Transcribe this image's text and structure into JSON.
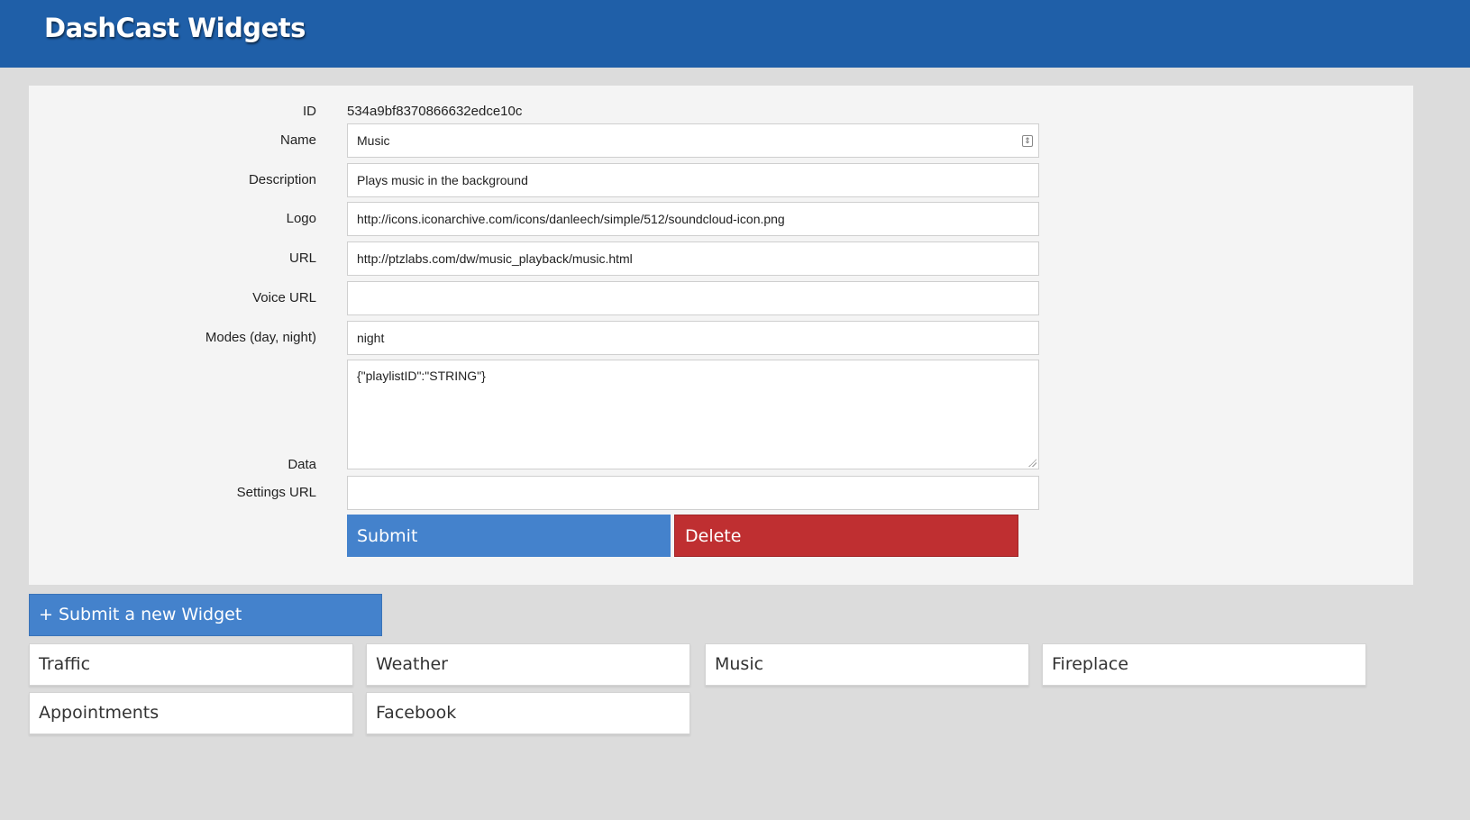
{
  "header": {
    "title": "DashCast Widgets"
  },
  "form": {
    "id": {
      "label": "ID",
      "value": "534a9bf8370866632edce10c"
    },
    "name": {
      "label": "Name",
      "value": "Music"
    },
    "description": {
      "label": "Description",
      "value": "Plays music in the background"
    },
    "logo": {
      "label": "Logo",
      "value": "http://icons.iconarchive.com/icons/danleech/simple/512/soundcloud-icon.png"
    },
    "url": {
      "label": "URL",
      "value": "http://ptzlabs.com/dw/music_playback/music.html"
    },
    "voice_url": {
      "label": "Voice URL",
      "value": ""
    },
    "modes": {
      "label": "Modes (day, night)",
      "value": "night"
    },
    "data": {
      "label": "Data",
      "value": "{\"playlistID\":\"STRING\"}"
    },
    "settings_url": {
      "label": "Settings URL",
      "value": ""
    },
    "submit_label": "Submit",
    "delete_label": "Delete"
  },
  "new_widget_label": "+ Submit a new Widget",
  "widgets": [
    "Traffic",
    "Weather",
    "Music",
    "Fireplace",
    "Appointments",
    "Facebook"
  ],
  "colors": {
    "header_bg": "#1f5fa8",
    "primary_button": "#4482cc",
    "danger_button": "#bf2f31"
  }
}
